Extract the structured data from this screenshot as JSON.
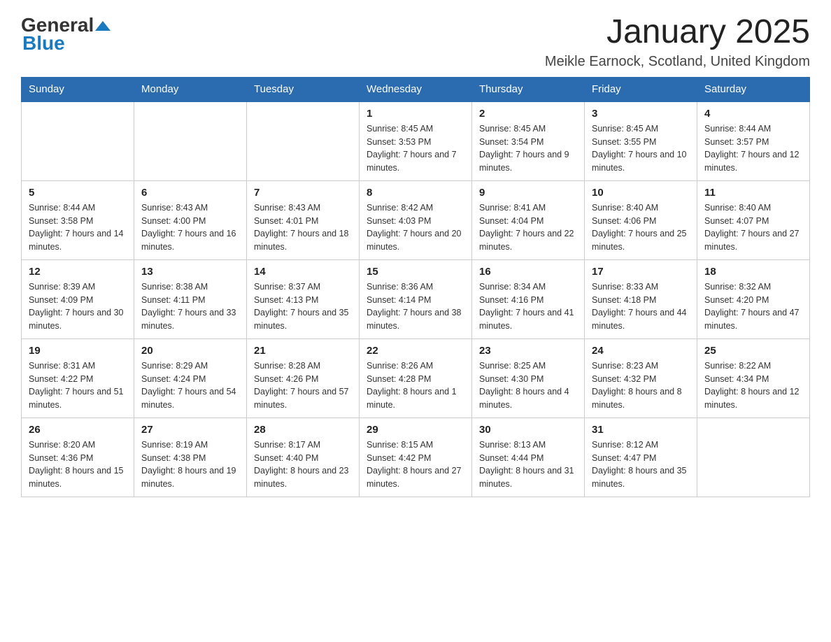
{
  "logo": {
    "general": "General",
    "blue": "Blue"
  },
  "title": "January 2025",
  "location": "Meikle Earnock, Scotland, United Kingdom",
  "days_of_week": [
    "Sunday",
    "Monday",
    "Tuesday",
    "Wednesday",
    "Thursday",
    "Friday",
    "Saturday"
  ],
  "weeks": [
    [
      {
        "day": "",
        "info": ""
      },
      {
        "day": "",
        "info": ""
      },
      {
        "day": "",
        "info": ""
      },
      {
        "day": "1",
        "info": "Sunrise: 8:45 AM\nSunset: 3:53 PM\nDaylight: 7 hours and 7 minutes."
      },
      {
        "day": "2",
        "info": "Sunrise: 8:45 AM\nSunset: 3:54 PM\nDaylight: 7 hours and 9 minutes."
      },
      {
        "day": "3",
        "info": "Sunrise: 8:45 AM\nSunset: 3:55 PM\nDaylight: 7 hours and 10 minutes."
      },
      {
        "day": "4",
        "info": "Sunrise: 8:44 AM\nSunset: 3:57 PM\nDaylight: 7 hours and 12 minutes."
      }
    ],
    [
      {
        "day": "5",
        "info": "Sunrise: 8:44 AM\nSunset: 3:58 PM\nDaylight: 7 hours and 14 minutes."
      },
      {
        "day": "6",
        "info": "Sunrise: 8:43 AM\nSunset: 4:00 PM\nDaylight: 7 hours and 16 minutes."
      },
      {
        "day": "7",
        "info": "Sunrise: 8:43 AM\nSunset: 4:01 PM\nDaylight: 7 hours and 18 minutes."
      },
      {
        "day": "8",
        "info": "Sunrise: 8:42 AM\nSunset: 4:03 PM\nDaylight: 7 hours and 20 minutes."
      },
      {
        "day": "9",
        "info": "Sunrise: 8:41 AM\nSunset: 4:04 PM\nDaylight: 7 hours and 22 minutes."
      },
      {
        "day": "10",
        "info": "Sunrise: 8:40 AM\nSunset: 4:06 PM\nDaylight: 7 hours and 25 minutes."
      },
      {
        "day": "11",
        "info": "Sunrise: 8:40 AM\nSunset: 4:07 PM\nDaylight: 7 hours and 27 minutes."
      }
    ],
    [
      {
        "day": "12",
        "info": "Sunrise: 8:39 AM\nSunset: 4:09 PM\nDaylight: 7 hours and 30 minutes."
      },
      {
        "day": "13",
        "info": "Sunrise: 8:38 AM\nSunset: 4:11 PM\nDaylight: 7 hours and 33 minutes."
      },
      {
        "day": "14",
        "info": "Sunrise: 8:37 AM\nSunset: 4:13 PM\nDaylight: 7 hours and 35 minutes."
      },
      {
        "day": "15",
        "info": "Sunrise: 8:36 AM\nSunset: 4:14 PM\nDaylight: 7 hours and 38 minutes."
      },
      {
        "day": "16",
        "info": "Sunrise: 8:34 AM\nSunset: 4:16 PM\nDaylight: 7 hours and 41 minutes."
      },
      {
        "day": "17",
        "info": "Sunrise: 8:33 AM\nSunset: 4:18 PM\nDaylight: 7 hours and 44 minutes."
      },
      {
        "day": "18",
        "info": "Sunrise: 8:32 AM\nSunset: 4:20 PM\nDaylight: 7 hours and 47 minutes."
      }
    ],
    [
      {
        "day": "19",
        "info": "Sunrise: 8:31 AM\nSunset: 4:22 PM\nDaylight: 7 hours and 51 minutes."
      },
      {
        "day": "20",
        "info": "Sunrise: 8:29 AM\nSunset: 4:24 PM\nDaylight: 7 hours and 54 minutes."
      },
      {
        "day": "21",
        "info": "Sunrise: 8:28 AM\nSunset: 4:26 PM\nDaylight: 7 hours and 57 minutes."
      },
      {
        "day": "22",
        "info": "Sunrise: 8:26 AM\nSunset: 4:28 PM\nDaylight: 8 hours and 1 minute."
      },
      {
        "day": "23",
        "info": "Sunrise: 8:25 AM\nSunset: 4:30 PM\nDaylight: 8 hours and 4 minutes."
      },
      {
        "day": "24",
        "info": "Sunrise: 8:23 AM\nSunset: 4:32 PM\nDaylight: 8 hours and 8 minutes."
      },
      {
        "day": "25",
        "info": "Sunrise: 8:22 AM\nSunset: 4:34 PM\nDaylight: 8 hours and 12 minutes."
      }
    ],
    [
      {
        "day": "26",
        "info": "Sunrise: 8:20 AM\nSunset: 4:36 PM\nDaylight: 8 hours and 15 minutes."
      },
      {
        "day": "27",
        "info": "Sunrise: 8:19 AM\nSunset: 4:38 PM\nDaylight: 8 hours and 19 minutes."
      },
      {
        "day": "28",
        "info": "Sunrise: 8:17 AM\nSunset: 4:40 PM\nDaylight: 8 hours and 23 minutes."
      },
      {
        "day": "29",
        "info": "Sunrise: 8:15 AM\nSunset: 4:42 PM\nDaylight: 8 hours and 27 minutes."
      },
      {
        "day": "30",
        "info": "Sunrise: 8:13 AM\nSunset: 4:44 PM\nDaylight: 8 hours and 31 minutes."
      },
      {
        "day": "31",
        "info": "Sunrise: 8:12 AM\nSunset: 4:47 PM\nDaylight: 8 hours and 35 minutes."
      },
      {
        "day": "",
        "info": ""
      }
    ]
  ]
}
